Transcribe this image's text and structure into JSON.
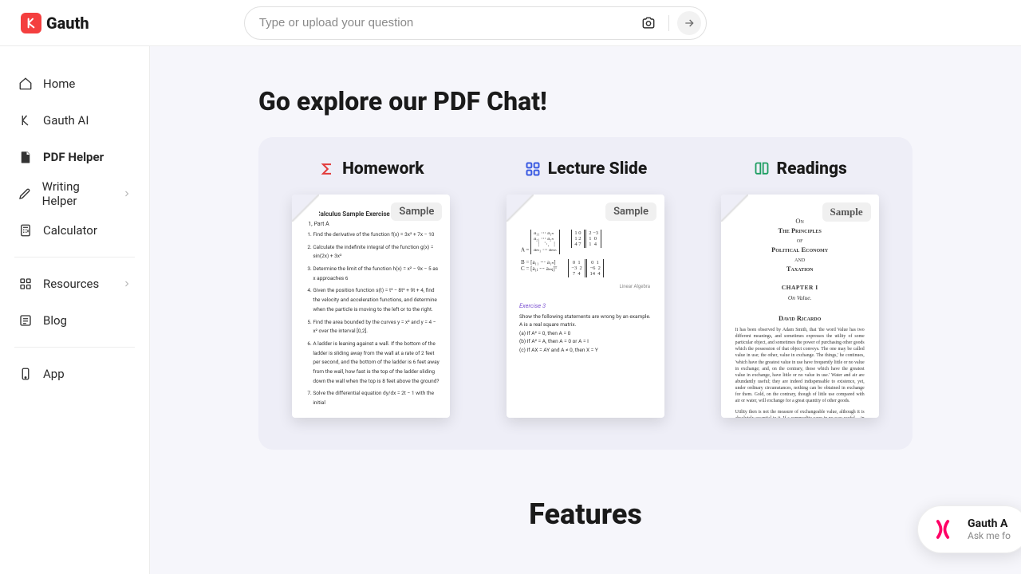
{
  "brand": {
    "name": "Gauth"
  },
  "search": {
    "placeholder": "Type or upload your question"
  },
  "sidebar": {
    "items": [
      {
        "label": "Home"
      },
      {
        "label": "Gauth AI"
      },
      {
        "label": "PDF Helper"
      },
      {
        "label": "Writing Helper"
      },
      {
        "label": "Calculator"
      },
      {
        "label": "Resources"
      },
      {
        "label": "Blog"
      },
      {
        "label": "App"
      }
    ]
  },
  "main": {
    "explore_title": "Go explore our PDF Chat!",
    "features_title": "Features",
    "cards": [
      {
        "title": "Homework",
        "badge": "Sample"
      },
      {
        "title": "Lecture Slide",
        "badge": "Sample"
      },
      {
        "title": "Readings",
        "badge": "Sample"
      }
    ],
    "homework_doc": {
      "title": "Calculus Sample Exercise",
      "subtitle": "1, Part A",
      "items": [
        "Find the derivative of the function  f(x) = 3x² + 7x − 10",
        "Calculate the indefinite integral of the function  g(x) = sin(2x) + 3x²",
        "Determine the limit of the function  h(x) = x² − 9x − 5  as  x approaches 6",
        "Given the position function  s(t) = t³ − 8t² + 9t + 4, find the velocity and acceleration functions, and determine when the particle is moving to the left or to the right.",
        "Find the area bounded by the curves  y = x²  and  y = 4 − x²  over the interval  [0,2].",
        "A ladder is leaning against a wall. If the bottom of the ladder is sliding away from the wall at a rate of 2 feet per second, and the bottom of the ladder is 6 feet away from the wall, how fast is the top of the ladder sliding down the wall when the top is 8 feet above the ground?",
        "Solve the differential equation  dy/dx = 2t − 1  with the initial"
      ]
    },
    "lecture_doc": {
      "exercise_label": "Exercise 3",
      "statement": "Show the following statements are wrong by an example. A is a real square matrix.",
      "lines": [
        "(a) If A² = 0, then A = 0",
        "(b) If A² = A, then A = 0 or A = I",
        "(c) If AX = AY and A ≠ 0, then X = Y"
      ],
      "footer": "Linear Algebra"
    },
    "readings_doc": {
      "l1": "On",
      "l2": "The Principles",
      "l3": "of",
      "l4": "Political Economy",
      "l5": "and",
      "l6": "Taxation",
      "chapter": "CHAPTER I",
      "subtitle": "On Value.",
      "author": "David Ricardo",
      "p1": "It has been observed by Adam Smith, that 'the word Value has two different meanings, and sometimes expresses the utility of some particular object, and sometimes the power of purchasing other goods which the possession of that object conveys. The one may be called value in use; the other, value in exchange. The things,' he continues, 'which have the greatest value in use have frequently little or no value in exchange; and, on the contrary, those which have the greatest value in exchange, have little or no value in use.' Water and air are abundantly useful; they are indeed indispensable to existence, yet, under ordinary circumstances, nothing can be obtained in exchange for them. Gold, on the contrary, though of little use compared with air or water, will exchange for a great quantity of other goods.",
      "p2": "Utility then is not the measure of exchangeable value, although it is absolutely essential to it. If a commodity were in no way useful,—in other words, if it could in no way contribute to our gratification,—it would be destitute of exchangeable value."
    }
  },
  "float": {
    "title": "Gauth A",
    "subtitle": "Ask me fo"
  }
}
